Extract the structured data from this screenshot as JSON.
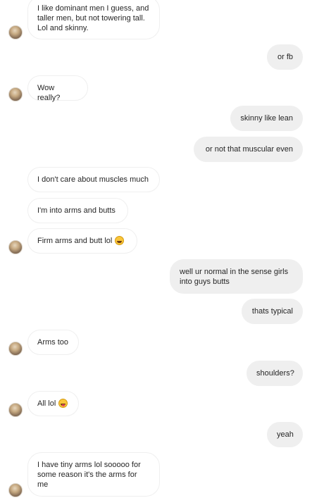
{
  "conversation": {
    "messages": [
      {
        "side": "in",
        "text": "I like dominant men I guess, and\ntaller men, but not towering tall.\nLol and skinny.",
        "emoji": ""
      },
      {
        "side": "out",
        "text": "or fb",
        "emoji": ""
      },
      {
        "side": "in",
        "text": "Wow really?",
        "emoji": ""
      },
      {
        "side": "out",
        "text": "skinny like lean",
        "emoji": ""
      },
      {
        "side": "out",
        "text": "or not that muscular even",
        "emoji": ""
      },
      {
        "side": "in",
        "text": "I don't care about muscles much",
        "emoji": ""
      },
      {
        "side": "in",
        "text": "I'm into arms and butts",
        "emoji": ""
      },
      {
        "side": "in",
        "text": "Firm arms and butt lol",
        "emoji": "laughing-face-emoji"
      },
      {
        "side": "out",
        "text": "well ur normal in the sense girls\ninto guys butts",
        "emoji": ""
      },
      {
        "side": "out",
        "text": "thats typical",
        "emoji": ""
      },
      {
        "side": "in",
        "text": "Arms too",
        "emoji": ""
      },
      {
        "side": "out",
        "text": "shoulders?",
        "emoji": ""
      },
      {
        "side": "in",
        "text": "All lol",
        "emoji": "tongue-face-emoji"
      },
      {
        "side": "out",
        "text": "yeah",
        "emoji": ""
      },
      {
        "side": "in",
        "text": "I have tiny arms lol sooooo for\nsome reason it's the arms for\nme",
        "emoji": ""
      }
    ]
  },
  "avatars": [
    "contact-avatar",
    "contact-avatar",
    "contact-avatar",
    "contact-avatar",
    "contact-avatar",
    "contact-avatar"
  ],
  "colors": {
    "incoming_bg": "#ffffff",
    "incoming_border": "#efefef",
    "outgoing_bg": "#efefef",
    "text": "#262626"
  }
}
